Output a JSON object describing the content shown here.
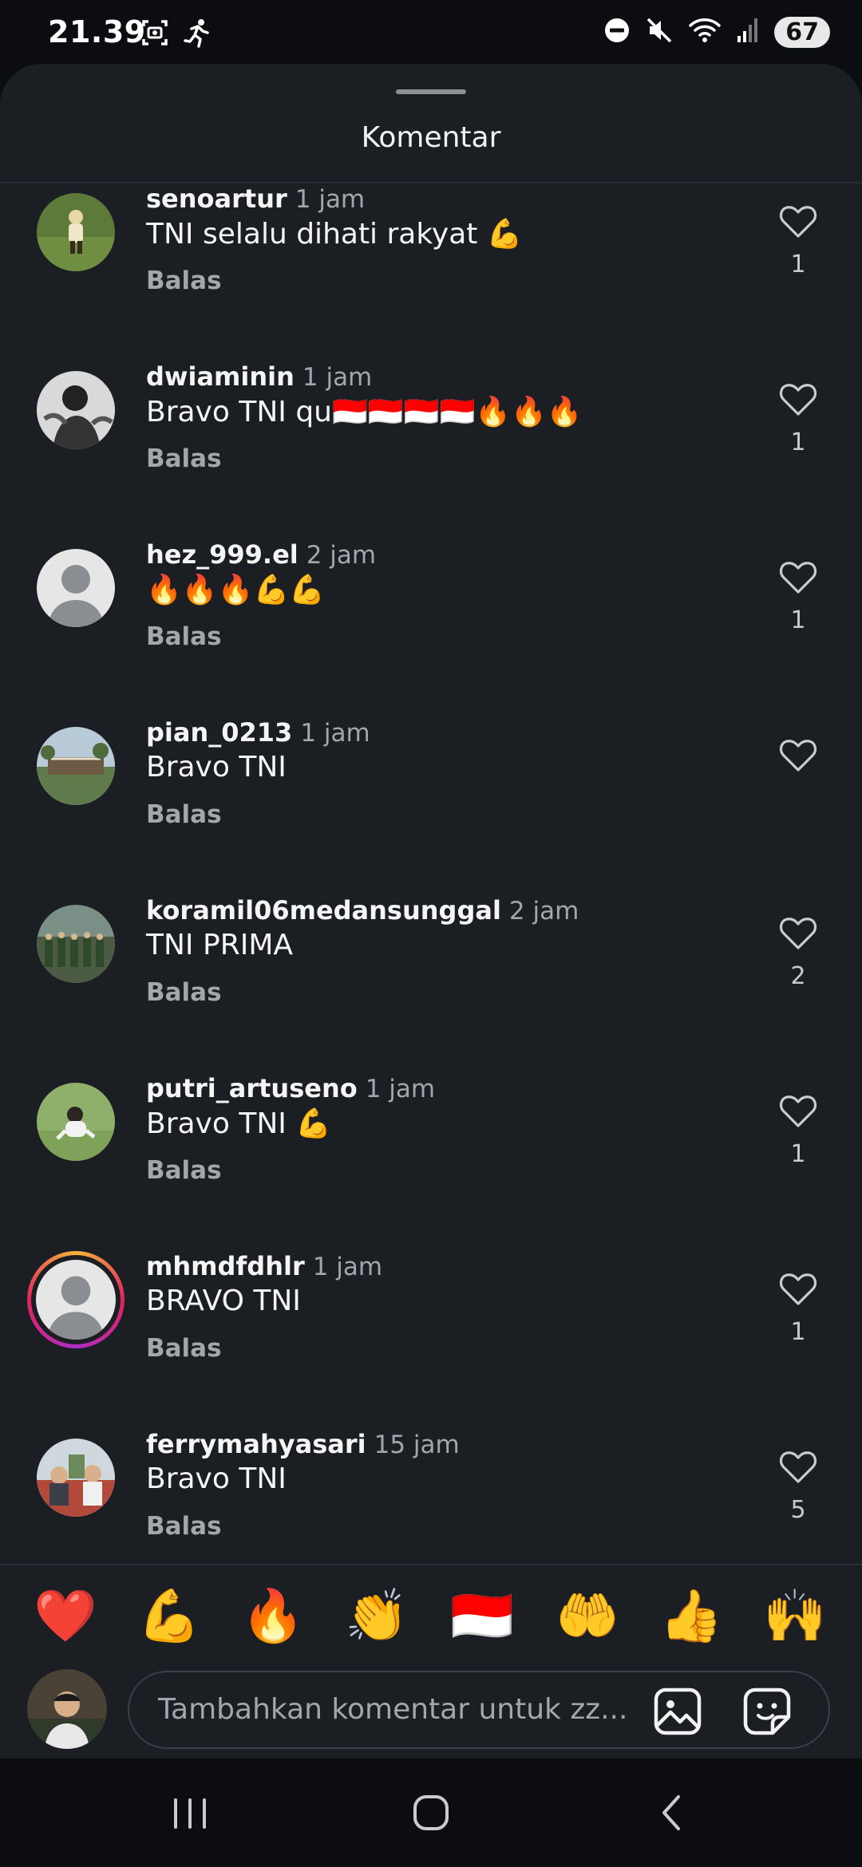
{
  "status_bar": {
    "time": "21.39",
    "battery": "67",
    "icons": [
      "screen-record-icon",
      "running-activity-icon",
      "do-not-disturb-icon",
      "mute-icon",
      "wifi-icon",
      "signal-icon"
    ]
  },
  "sheet": {
    "title": "Komentar"
  },
  "comments": [
    {
      "username": "senoartur",
      "time": "1 jam",
      "text": "TNI selalu dihati rakyat 💪",
      "reply": "Balas",
      "likes": "1"
    },
    {
      "username": "dwiaminin",
      "time": "1 jam",
      "text": "Bravo TNI qu🇮🇩🇮🇩🇮🇩🇮🇩🔥🔥🔥",
      "reply": "Balas",
      "likes": "1"
    },
    {
      "username": "hez_999.el",
      "time": "2 jam",
      "text": "🔥🔥🔥💪💪",
      "reply": "Balas",
      "likes": "1"
    },
    {
      "username": "pian_0213",
      "time": "1 jam",
      "text": "Bravo TNI",
      "reply": "Balas",
      "likes": ""
    },
    {
      "username": "koramil06medansunggal",
      "time": "2 jam",
      "text": "TNI PRIMA",
      "reply": "Balas",
      "likes": "2"
    },
    {
      "username": "putri_artuseno",
      "time": "1 jam",
      "text": "Bravo TNI 💪",
      "reply": "Balas",
      "likes": "1"
    },
    {
      "username": "mhmdfdhlr",
      "time": "1 jam",
      "text": "BRAVO TNI",
      "reply": "Balas",
      "likes": "1"
    },
    {
      "username": "ferrymahyasari",
      "time": "15 jam",
      "text": "Bravo TNI",
      "reply": "Balas",
      "likes": "5"
    }
  ],
  "quick_reactions": [
    "❤️",
    "💪",
    "🔥",
    "👏",
    "🇮🇩",
    "🤲",
    "👍",
    "🙌"
  ],
  "input": {
    "placeholder": "Tambahkan komentar untuk zz..."
  },
  "colors": {
    "sheet_bg": "#1b1e23",
    "system_bg": "#0b0d10",
    "secondary_text": "#a3a6ab"
  }
}
